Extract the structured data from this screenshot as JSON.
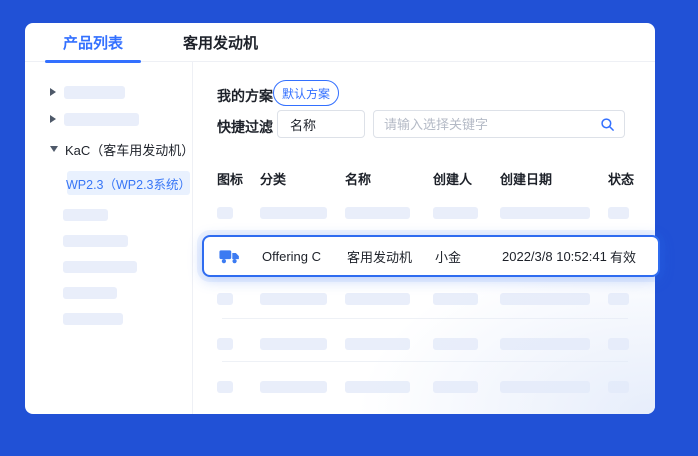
{
  "window": {
    "tabs": [
      {
        "label": "产品列表"
      },
      {
        "label": "客用发动机"
      }
    ]
  },
  "sidebar": {
    "expanded_node_label": "KaC（客车用发动机）",
    "selected_child_label": "WP2.3（WP2.3系统）"
  },
  "plan": {
    "my_plan_label": "我的方案",
    "default_plan_button": "默认方案"
  },
  "filter": {
    "label": "快捷过滤",
    "field_value": "名称",
    "search_placeholder": "请输入选择关键字",
    "search_icon": "search-icon"
  },
  "table": {
    "headers": [
      "图标",
      "分类",
      "名称",
      "创建人",
      "创建日期",
      "状态"
    ],
    "highlighted_row": {
      "icon": "truck-icon",
      "category": "Offering C",
      "name": "客用发动机",
      "creator": "小金",
      "created_date": "2022/3/8 10:52:41",
      "status": "有效"
    }
  },
  "colors": {
    "page_background": "#2151d6",
    "accent_blue": "#3370ff",
    "row_border_blue": "#2f6cf0",
    "selected_tree_bg": "#e9f1fe",
    "skeleton": "#e9eefa"
  }
}
